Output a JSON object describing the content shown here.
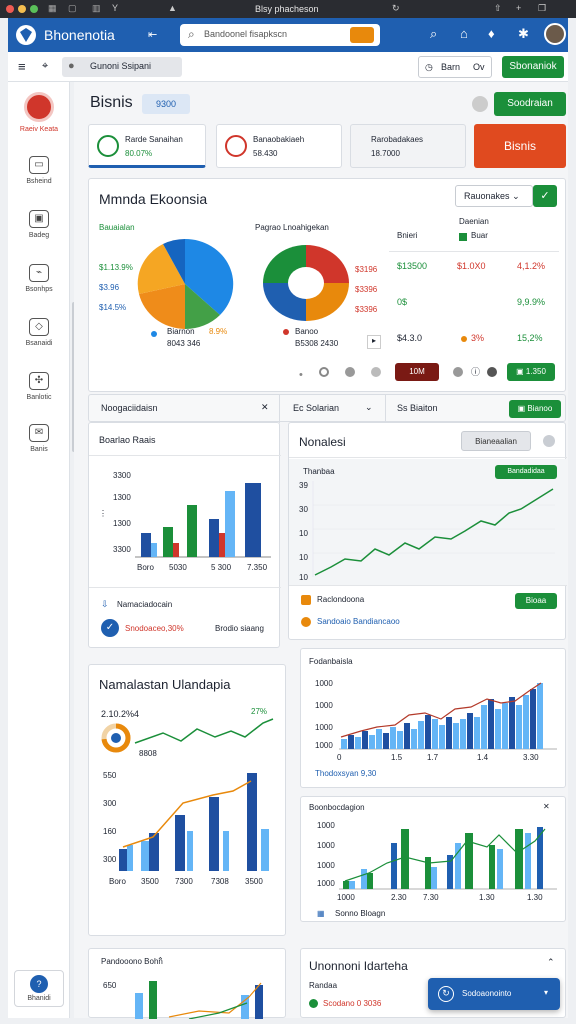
{
  "titlebar": {
    "title": "Blsy phacheson",
    "app_icon_label": "Y"
  },
  "app": {
    "name": "Bhonenotia",
    "search_placeholder": "Bandoonel fisapkscn"
  },
  "toolbar": {
    "dropdown_label": "Gunoni Ssipani",
    "filter_label": "Barn",
    "filter_value": "Ov",
    "action_label": "Sbonaniok"
  },
  "sidebar": {
    "items": [
      {
        "label": "Raeiv Keata"
      },
      {
        "label": "Bsheind"
      },
      {
        "label": "Badeg"
      },
      {
        "label": "Bsonhps"
      },
      {
        "label": "Bsanaidi"
      },
      {
        "label": "Banlotic"
      },
      {
        "label": "Banis"
      }
    ],
    "bottom_label": "Bhanidi"
  },
  "header": {
    "title": "Bisnis",
    "badge": "9300",
    "action": "Soodraian"
  },
  "kpis": [
    {
      "title": "Rarde Sanaihan",
      "value": "80.07%"
    },
    {
      "title": "Banaobakiaeh",
      "value": "58.430"
    },
    {
      "title": "Rarobadakaes",
      "value": "18.7000"
    },
    {
      "title": "Bisnis"
    }
  ],
  "overview": {
    "title": "Mmnda Ekoonsia",
    "select_label": "Rauonakes",
    "pie1": {
      "label": "Bauaialan",
      "values": [
        "$1.13.9%",
        "$3.96",
        "$14.5%"
      ],
      "legend": "Biarnon",
      "legend_value": "8.9%",
      "legend_sub": "8043 346"
    },
    "pie2": {
      "label": "Pagrao Lnoahigekan",
      "values": [
        "$3196",
        "$3396",
        "$3396"
      ],
      "legend": "Banoo",
      "legend_sub": "B5308 2430"
    },
    "table": {
      "col1": "Bnieri",
      "col2": "Daenian",
      "col2_sub": "Buar",
      "rows": [
        {
          "a": "$13500",
          "b": "$1.0X0",
          "c": "4,1.2%"
        },
        {
          "a": "0$",
          "b": "",
          "c": "9,9.9%"
        },
        {
          "a": "$4.3.0",
          "b": "3%",
          "c": "15,2%"
        }
      ],
      "badge": "10M",
      "action": "1.350"
    }
  },
  "row_header": {
    "left": "Noogaciidaisn",
    "mid": "Ec Solarian",
    "right": "Ss Biaiton",
    "action": "Bianoo"
  },
  "bar_card": {
    "title": "Boarlao Raais",
    "yticks": [
      "3300",
      "1300",
      "1300",
      "3300"
    ],
    "xticks": [
      "Boro",
      "5030",
      "5 300",
      "7.350"
    ],
    "footer": "Namaciadocain",
    "footer_value": "Snodoaceo,30%",
    "footer_sub": "Brodio siaang"
  },
  "line_card": {
    "title": "Nonalesi",
    "button": "Bianeaalian",
    "inner_title": "Thanbaa",
    "inner_badge": "Bandadidaa",
    "yticks": [
      "39",
      "30",
      "10",
      "10",
      "10"
    ],
    "footer": "Raclondoona",
    "footer_sub": "Sandoaio Bandiancaoo",
    "footer_action": "Bioaa"
  },
  "bottom_left": {
    "title": "Namalastan Ulandapia",
    "value": "2.10.2%4",
    "pct": "27%",
    "donut_label": "8808",
    "yticks": [
      "550",
      "300",
      "160",
      "300"
    ],
    "xticks": [
      "Boro",
      "3500",
      "7300",
      "7308",
      "3500"
    ]
  },
  "bottom_right1": {
    "title": "Fodanbaisla",
    "yticks": [
      "1000",
      "1000",
      "1000",
      "1000",
      "0"
    ],
    "xticks": [
      "0",
      "1.5",
      "1.7",
      "1.4",
      "3.30"
    ],
    "footer": "Thodoxsyan 9,30"
  },
  "bottom_right2": {
    "title": "Boonbocdagion",
    "yticks": [
      "1000",
      "1000",
      "1000",
      "1000"
    ],
    "xticks": [
      "1000",
      "2.30",
      "7.30",
      "1.30",
      "1.30"
    ],
    "footer": "Sonno Bloagn"
  },
  "footer_left": {
    "title": "Pandooono Bohn"
  },
  "footer_right": {
    "title": "Unonnoni Idarteha",
    "subtitle": "Randaa",
    "value": "Scodano 0 3036"
  },
  "fab": {
    "label": "Sodoaonointo"
  },
  "colors": {
    "brand": "#1f5fb0",
    "green": "#1b8f3a",
    "red": "#d0362b",
    "orange": "#e8890c"
  }
}
